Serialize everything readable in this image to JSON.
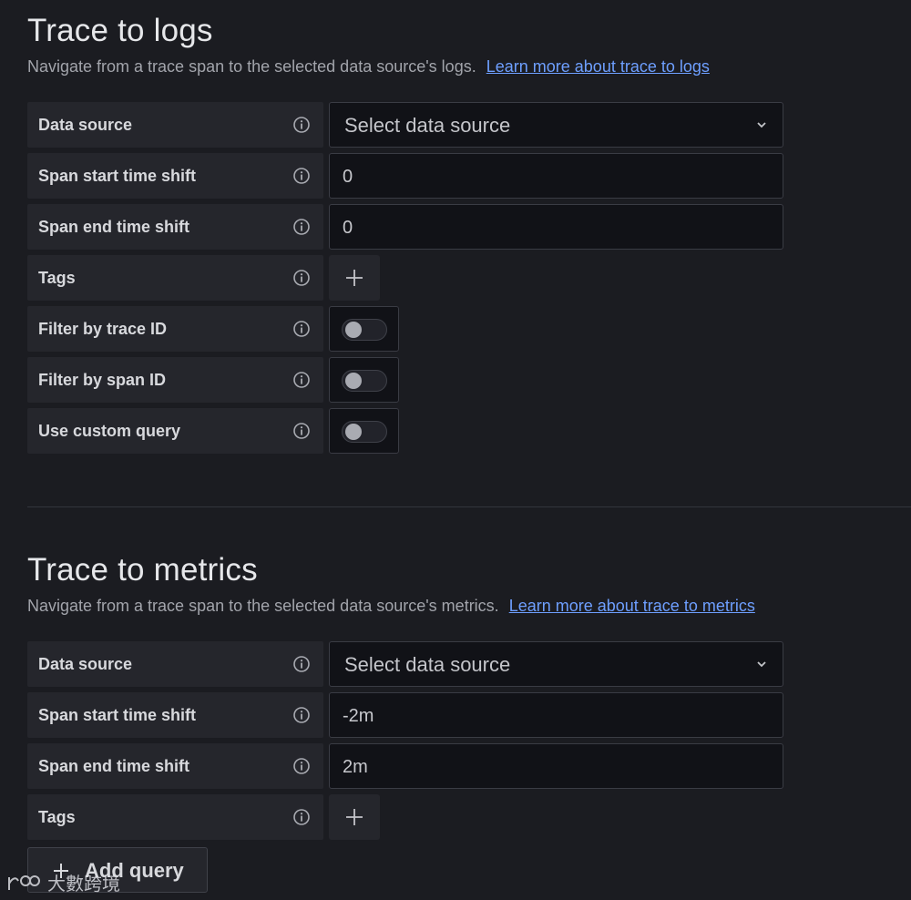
{
  "logs": {
    "title": "Trace to logs",
    "description": "Navigate from a trace span to the selected data source's logs.",
    "link": "Learn more about trace to logs",
    "rows": {
      "datasource": {
        "label": "Data source",
        "placeholder": "Select data source"
      },
      "start_shift": {
        "label": "Span start time shift",
        "value": "0"
      },
      "end_shift": {
        "label": "Span end time shift",
        "value": "0"
      },
      "tags": {
        "label": "Tags"
      },
      "filter_trace": {
        "label": "Filter by trace ID",
        "enabled": false
      },
      "filter_span": {
        "label": "Filter by span ID",
        "enabled": false
      },
      "custom_query": {
        "label": "Use custom query",
        "enabled": false
      }
    }
  },
  "metrics": {
    "title": "Trace to metrics",
    "description": "Navigate from a trace span to the selected data source's metrics.",
    "link": "Learn more about trace to metrics",
    "rows": {
      "datasource": {
        "label": "Data source",
        "placeholder": "Select data source"
      },
      "start_shift": {
        "label": "Span start time shift",
        "value": "-2m"
      },
      "end_shift": {
        "label": "Span end time shift",
        "value": "2m"
      },
      "tags": {
        "label": "Tags"
      }
    },
    "add_query": "Add query"
  },
  "watermark": {
    "text": "大數跨境"
  },
  "colors": {
    "background": "#1b1c21",
    "label_bg": "#25262c",
    "input_bg": "#111217",
    "link": "#6e9fff"
  },
  "icons": {
    "info": "info-circle-icon",
    "dropdown": "chevron-down-icon",
    "add": "plus-icon"
  }
}
